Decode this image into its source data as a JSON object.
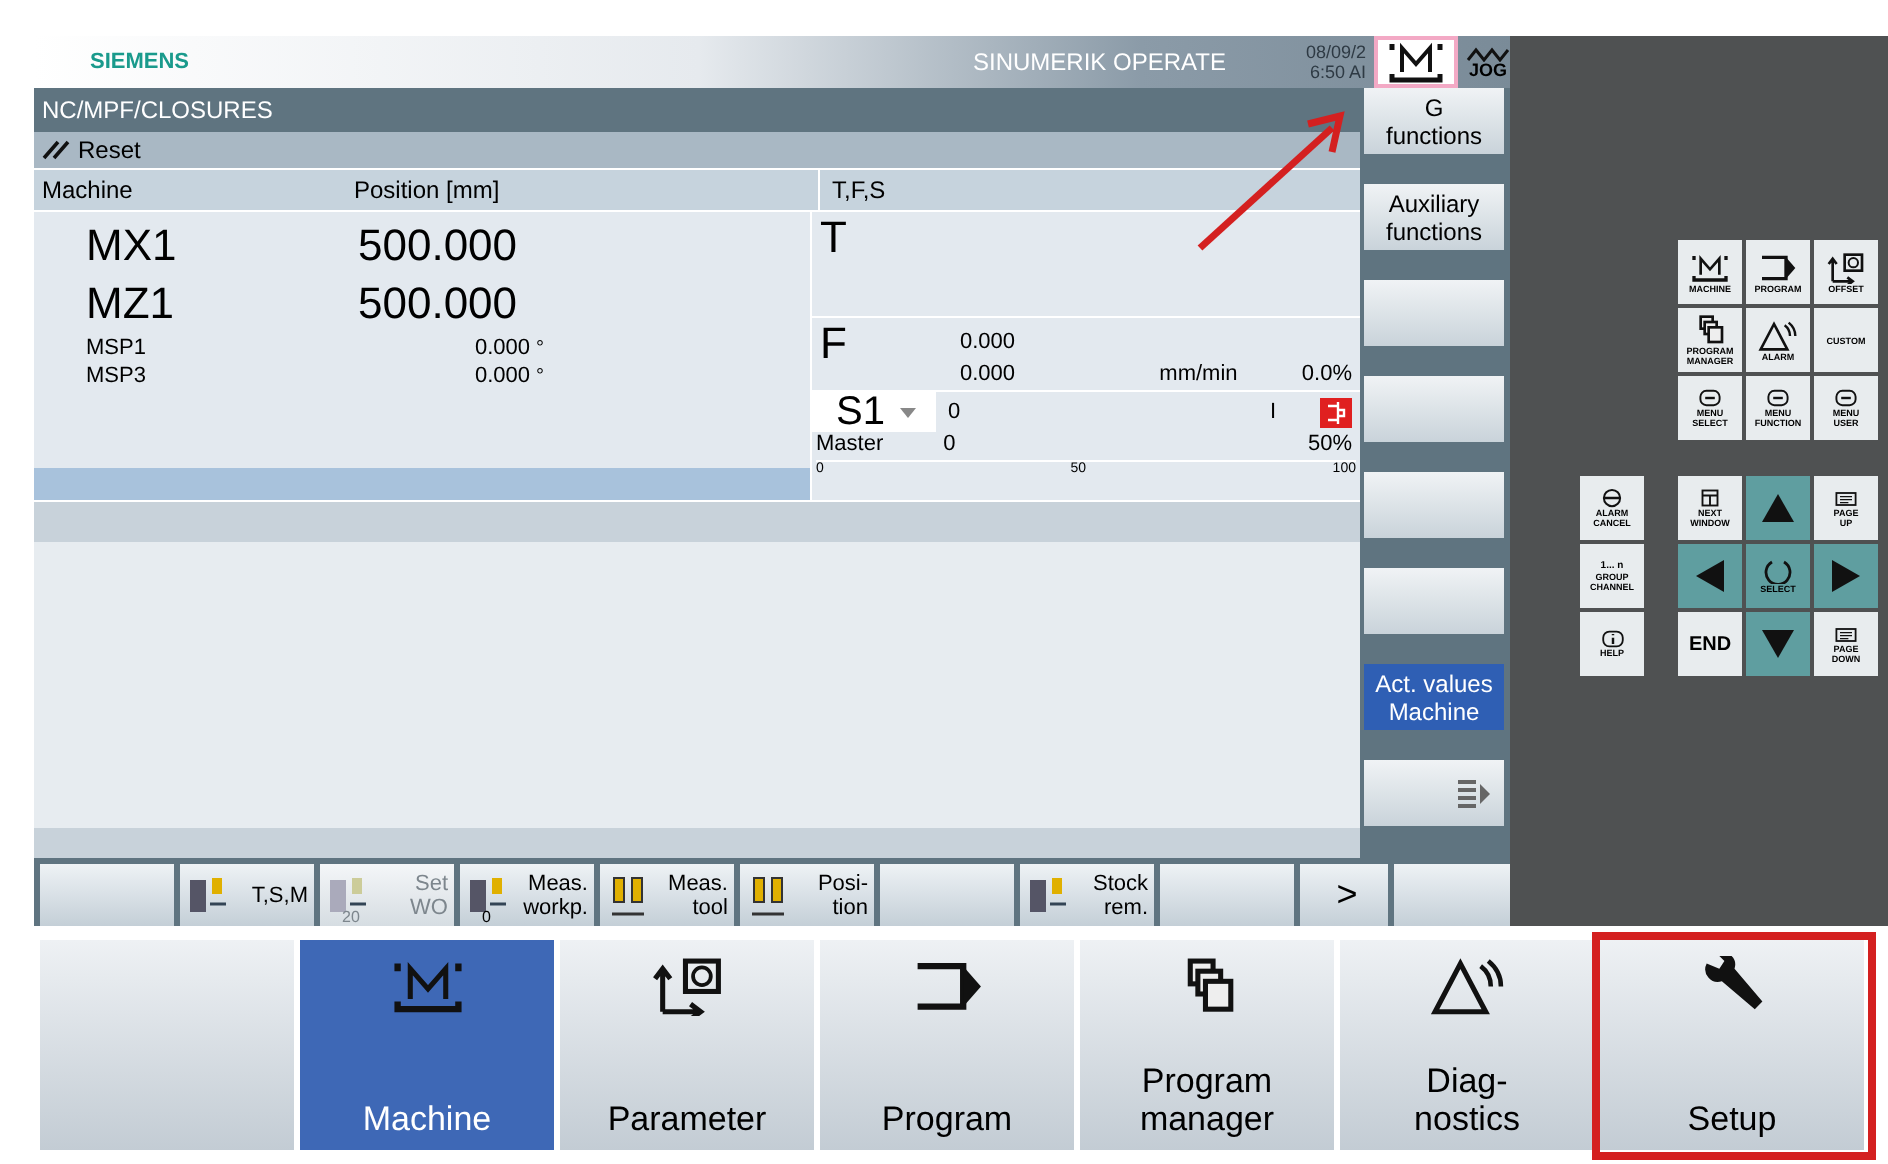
{
  "header": {
    "brand": "SIEMENS",
    "product": "SINUMERIK OPERATE",
    "date": "08/09/2",
    "time": "6:50 AI",
    "mode": "JOG"
  },
  "path": "NC/MPF/CLOSURES",
  "channel_status": "Reset",
  "position_table": {
    "columns": [
      "Machine",
      "Position [mm]",
      "T,F,S"
    ],
    "axes": [
      {
        "name": "MX1",
        "value": "500.000",
        "kind": "large"
      },
      {
        "name": "MZ1",
        "value": "500.000",
        "kind": "large"
      },
      {
        "name": "MSP1",
        "value": "0.000",
        "unit": "°",
        "kind": "small"
      },
      {
        "name": "MSP3",
        "value": "0.000",
        "unit": "°",
        "kind": "small"
      }
    ]
  },
  "tfs": {
    "tool_label": "T",
    "feed_label": "F",
    "feed_set": "0.000",
    "feed_actual": "0.000",
    "feed_unit": "mm/min",
    "feed_override": "0.0%",
    "spindle": {
      "name": "S1",
      "set": "0",
      "marker": "I",
      "role": "Master",
      "actual": "0",
      "override": "50%",
      "scale": [
        "0",
        "50",
        "100"
      ]
    }
  },
  "vertical_softkeys": [
    {
      "kind": "text",
      "label": "G\nfunctions",
      "selected": false
    },
    {
      "kind": "text",
      "label": "Auxiliary\nfunctions",
      "selected": false
    },
    {
      "kind": "blank",
      "selected": false
    },
    {
      "kind": "blank",
      "selected": false
    },
    {
      "kind": "blank",
      "selected": false
    },
    {
      "kind": "blank",
      "selected": false
    },
    {
      "kind": "text",
      "label": "Act. values\nMachine",
      "selected": true
    },
    {
      "kind": "more",
      "selected": false
    }
  ],
  "horizontal_softkeys": [
    {
      "kind": "blank",
      "disabled": false
    },
    {
      "kind": "tsm",
      "label": "T,S,M",
      "disabled": false
    },
    {
      "kind": "setwo",
      "label": "Set\nWO",
      "icon_text": "20",
      "disabled": true
    },
    {
      "kind": "measwork",
      "label": "Meas.\nworkp.",
      "icon_text": "0",
      "disabled": false
    },
    {
      "kind": "meastool",
      "label": "Meas.\ntool",
      "disabled": false
    },
    {
      "kind": "position",
      "label": "Posi-\ntion",
      "disabled": false
    },
    {
      "kind": "blank",
      "disabled": false
    },
    {
      "kind": "stock",
      "label": "Stock\nrem.",
      "disabled": false
    },
    {
      "kind": "blank",
      "disabled": false
    },
    {
      "kind": "next",
      "label": ">",
      "disabled": false
    },
    {
      "kind": "blank",
      "disabled": false
    }
  ],
  "keypad_top": [
    {
      "kind": "machine",
      "label": "MACHINE"
    },
    {
      "kind": "program",
      "label": "PROGRAM"
    },
    {
      "kind": "offset",
      "label": "OFFSET"
    },
    {
      "kind": "manager",
      "label": "PROGRAM\nMANAGER"
    },
    {
      "kind": "alarm",
      "label": "ALARM"
    },
    {
      "kind": "plain",
      "label": "CUSTOM"
    },
    {
      "kind": "menu",
      "label": "MENU\nSELECT"
    },
    {
      "kind": "menu",
      "label": "MENU\nFUNCTION"
    },
    {
      "kind": "menu",
      "label": "MENU\nUSER"
    }
  ],
  "keypad_bottom": [
    {
      "kind": "alarmcancel",
      "label": "ALARM\nCANCEL"
    },
    {
      "kind": "window",
      "label": "NEXT\nWINDOW"
    },
    {
      "kind": "up"
    },
    {
      "kind": "pageup",
      "label": "PAGE\nUP"
    },
    {
      "kind": "group",
      "label": "GROUP\nCHANNEL",
      "icon_text": "1... n"
    },
    {
      "kind": "left"
    },
    {
      "kind": "select",
      "label": "SELECT"
    },
    {
      "kind": "right"
    },
    {
      "kind": "help",
      "label": "HELP"
    },
    {
      "kind": "end",
      "label": "END"
    },
    {
      "kind": "down"
    },
    {
      "kind": "pagedown",
      "label": "PAGE\nDOWN"
    }
  ],
  "operating_areas": [
    {
      "kind": "blank",
      "selected": false
    },
    {
      "kind": "machine",
      "label": "Machine",
      "selected": true
    },
    {
      "kind": "parameter",
      "label": "Parameter",
      "selected": false
    },
    {
      "kind": "program",
      "label": "Program",
      "selected": false
    },
    {
      "kind": "manager",
      "label": "Program\nmanager",
      "selected": false
    },
    {
      "kind": "diagnostics",
      "label": "Diag-\nnostics",
      "selected": false
    },
    {
      "kind": "setup",
      "label": "Setup",
      "selected": false
    }
  ]
}
